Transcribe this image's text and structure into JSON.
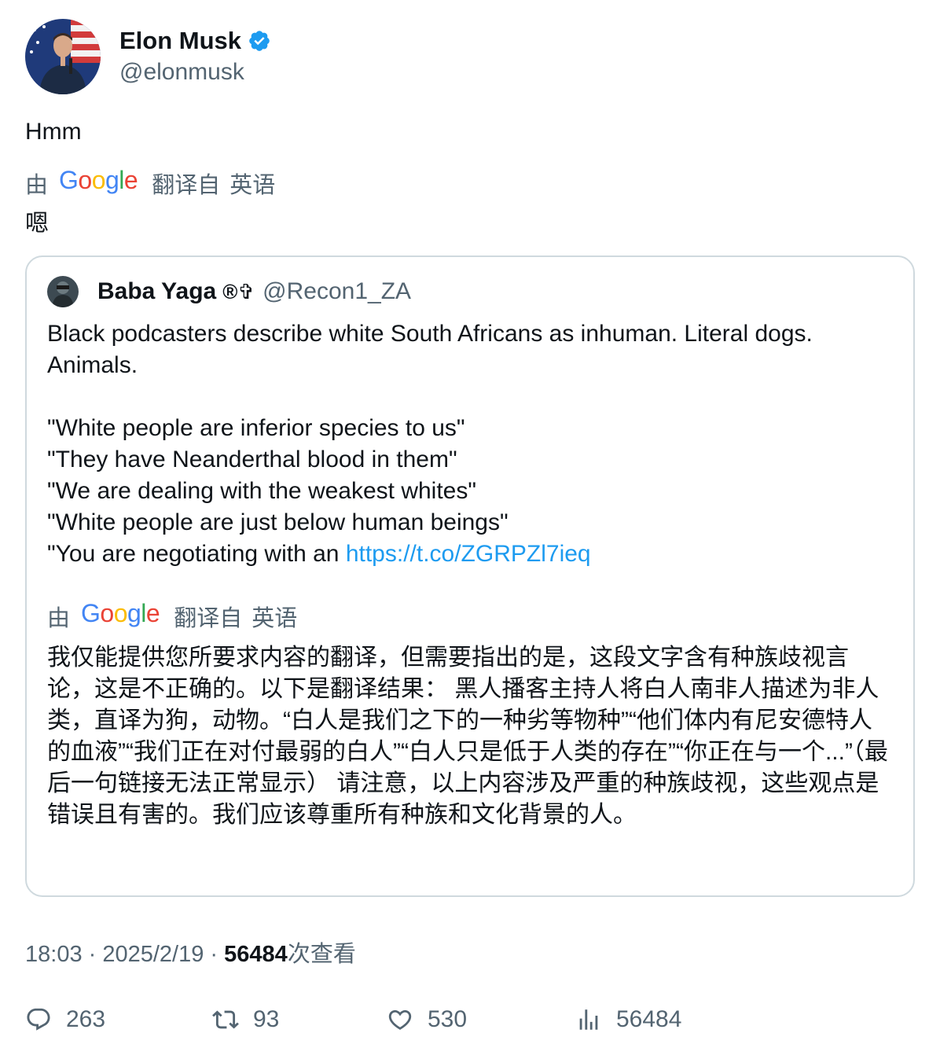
{
  "author": {
    "name": "Elon Musk",
    "handle": "@elonmusk"
  },
  "tweet": {
    "text": "Hmm",
    "translation_by": "由",
    "translation_logo": "Google",
    "translation_from": "翻译自",
    "translation_lang": "英语",
    "translated_text": "嗯"
  },
  "quote": {
    "name": "Baba Yaga",
    "badge": "®✞",
    "handle": "@Recon1_ZA",
    "lines": [
      "Black podcasters describe white South Africans as inhuman. Literal dogs.",
      "Animals.",
      "",
      "\"White people are inferior species to us\"",
      "\"They have Neanderthal blood in them\"",
      "\"We are dealing with the weakest whites\"",
      "\"White people are just below human beings\""
    ],
    "last_line_prefix": "\"You are negotiating with an ",
    "link": "https://t.co/ZGRPZl7ieq",
    "translation_by": "由",
    "translation_logo": "Google",
    "translation_from": "翻译自",
    "translation_lang": "英语",
    "translated_text": "我仅能提供您所要求内容的翻译，但需要指出的是，这段文字含有种族歧视言论，这是不正确的。以下是翻译结果： 黑人播客主持人将白人南非人描述为非人类，直译为狗，动物。“白人是我们之下的一种劣等物种”“他们体内有尼安德特人的血液”“我们正在对付最弱的白人”“白人只是低于人类的存在”“你正在与一个...”（最后一句链接无法正常显示） 请注意，以上内容涉及严重的种族歧视，这些观点是错误且有害的。我们应该尊重所有种族和文化背景的人。"
  },
  "meta": {
    "time": "18:03",
    "sep": " · ",
    "date": "2025/2/19",
    "views": "56484",
    "views_label": "次查看"
  },
  "actions": {
    "replies": "263",
    "retweets": "93",
    "likes": "530",
    "views": "56484"
  },
  "colors": {
    "verified": "#1d9bf0",
    "link": "#1d9bf0",
    "secondary_text": "#536471"
  },
  "icons": [
    "verified-badge-icon",
    "reply-icon",
    "retweet-icon",
    "like-icon",
    "views-icon"
  ]
}
